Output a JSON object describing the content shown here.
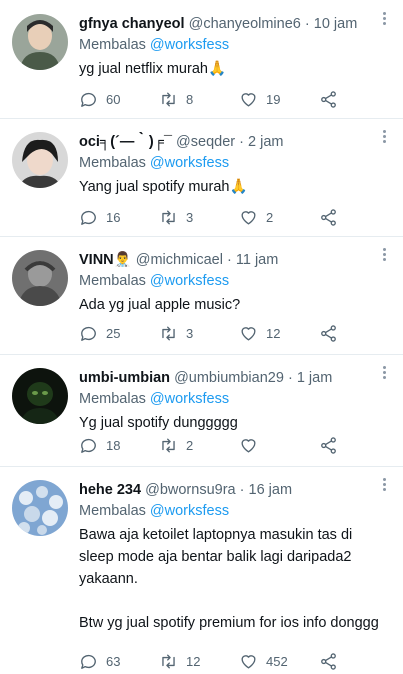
{
  "tweets": [
    {
      "name": "gfnya chanyeol",
      "handle": "@chanyeolmine6",
      "time": "10 jam",
      "reply_prefix": "Membalas",
      "reply_to": "@worksfess",
      "text": "yg jual netflix murah🙏",
      "replies": "60",
      "retweets": "8",
      "likes": "19"
    },
    {
      "name": "oci╕(´—｀)╒¯",
      "handle": "@seqder",
      "time": "2 jam",
      "reply_prefix": "Membalas",
      "reply_to": "@worksfess",
      "text": "Yang jual spotify murah🙏",
      "replies": "16",
      "retweets": "3",
      "likes": "2"
    },
    {
      "name": "VINN👨‍⚕️",
      "handle": "@michmicael",
      "time": "11 jam",
      "reply_prefix": "Membalas",
      "reply_to": "@worksfess",
      "text": "Ada yg jual apple music?",
      "replies": "25",
      "retweets": "3",
      "likes": "12"
    },
    {
      "name": "umbi-umbian",
      "handle": "@umbiumbian29",
      "time": "1 jam",
      "reply_prefix": "Membalas",
      "reply_to": "@worksfess",
      "text": "Yg jual spotify dunggggg",
      "replies": "18",
      "retweets": "2",
      "likes": ""
    },
    {
      "name": "hehe 234",
      "handle": "@bwornsu9ra",
      "time": "16 jam",
      "reply_prefix": "Membalas",
      "reply_to": "@worksfess",
      "text": "Bawa aja ketoilet laptopnya masukin tas di sleep mode aja bentar balik lagi daripada2 yakaann.\n\nBtw yg jual spotify premium for ios info donggg",
      "replies": "63",
      "retweets": "12",
      "likes": "452"
    }
  ],
  "separator": "·",
  "icons": [
    "reply-icon",
    "retweet-icon",
    "like-icon",
    "share-icon",
    "more-icon"
  ],
  "colors": {
    "mention": "#1d9bf0",
    "secondary_text": "#536471",
    "primary_text": "#0f1419"
  }
}
